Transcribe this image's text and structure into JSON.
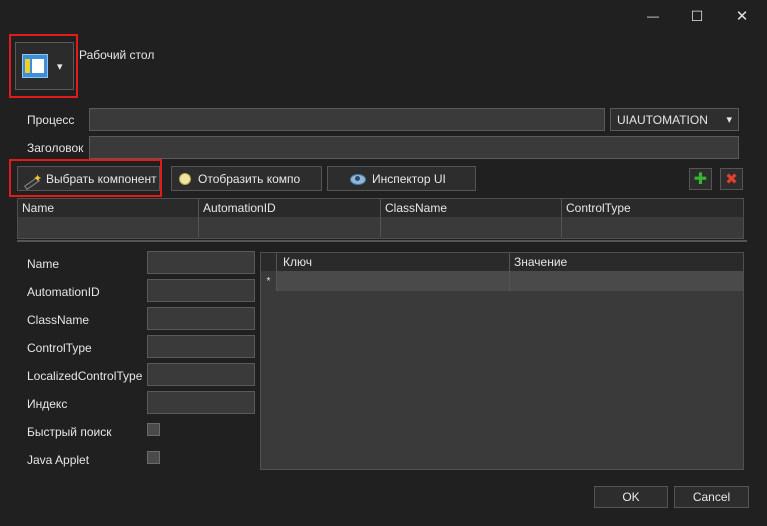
{
  "window": {
    "minimize_glyph": "—",
    "maximize_glyph": "☐",
    "close_glyph": "✕"
  },
  "target": {
    "icon": "window-icon",
    "dropdown_glyph": "▾",
    "label": "Рабочий стол"
  },
  "form": {
    "process_label": "Процесс",
    "process_value": "",
    "title_label": "Заголовок",
    "title_value": "",
    "mode_value": "UIAUTOMATION",
    "mode_glyph": "▾"
  },
  "toolbar": {
    "select_label": "Выбрать компонент",
    "show_label": "Отобразить компо",
    "inspector_label": "Инспектор UI",
    "add_glyph": "✚",
    "delete_glyph": "✖"
  },
  "elements_grid": {
    "columns": [
      "Name",
      "AutomationID",
      "ClassName",
      "ControlType"
    ]
  },
  "properties": {
    "rows": [
      {
        "label": "Name",
        "value": ""
      },
      {
        "label": "AutomationID",
        "value": ""
      },
      {
        "label": "ClassName",
        "value": ""
      },
      {
        "label": "ControlType",
        "value": ""
      },
      {
        "label": "LocalizedControlType",
        "value": ""
      },
      {
        "label": "Индекс",
        "value": ""
      }
    ],
    "fast_search_label": "Быстрый поиск",
    "java_applet_label": "Java Applet"
  },
  "kv_grid": {
    "columns": [
      "Ключ",
      "Значение"
    ],
    "new_row_marker": "*"
  },
  "footer": {
    "ok_label": "OK",
    "cancel_label": "Cancel"
  },
  "colors": {
    "background": "#202020",
    "highlight": "#e01b1b",
    "add": "#2e9b2e",
    "delete": "#d23a2a"
  }
}
